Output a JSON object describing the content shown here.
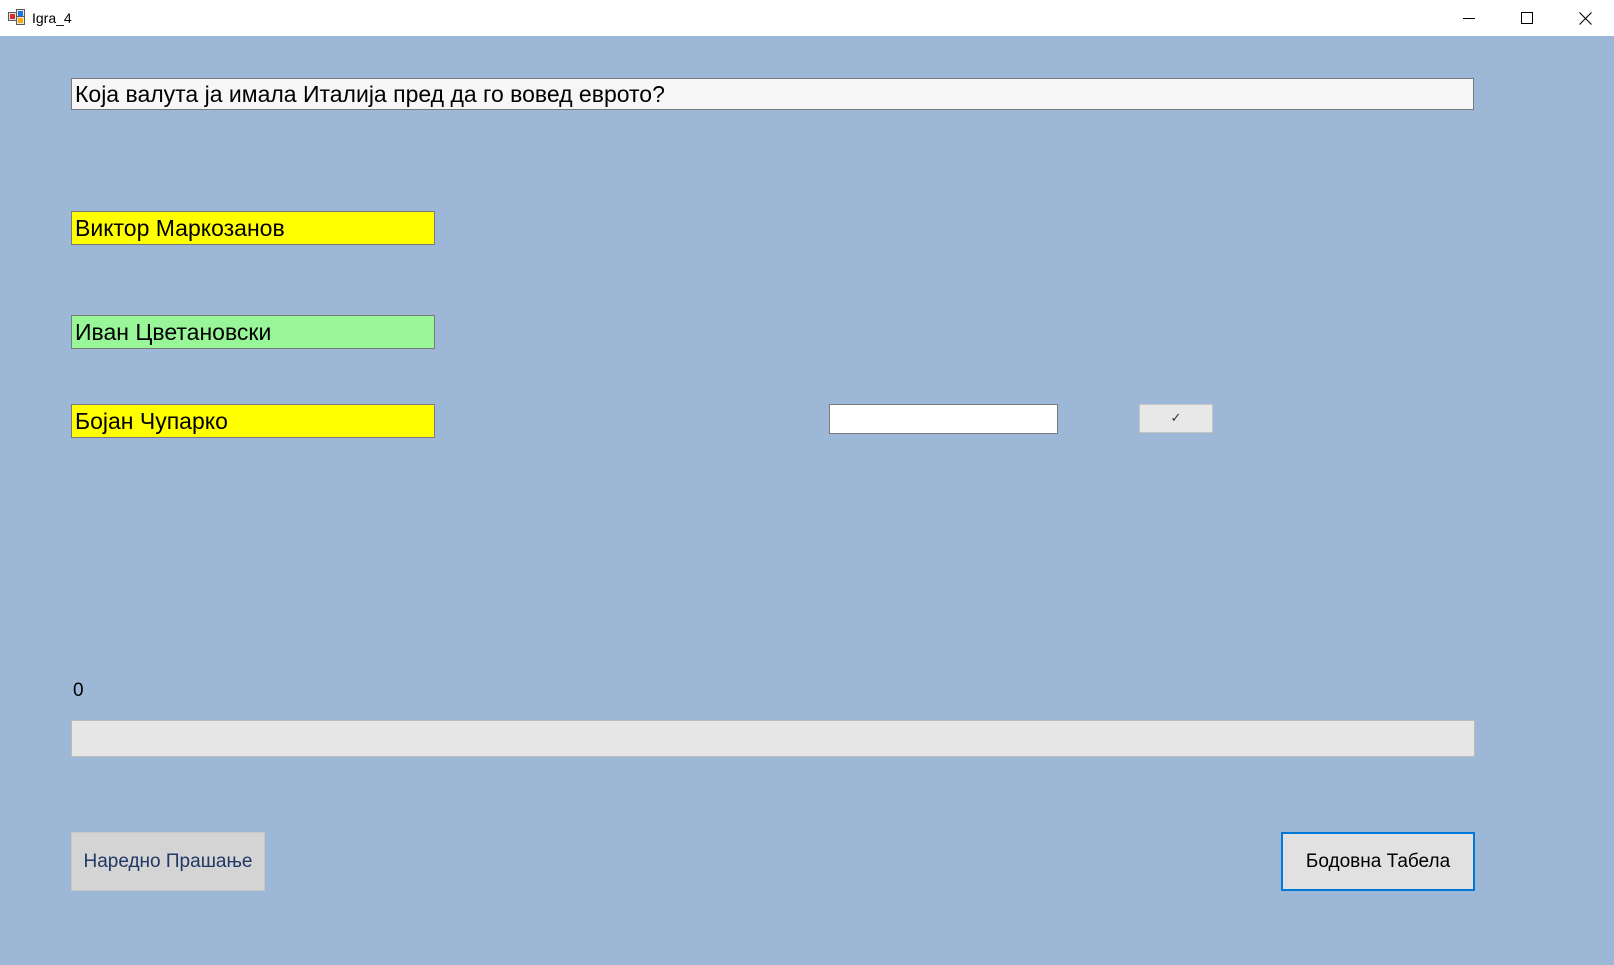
{
  "window": {
    "title": "Igra_4"
  },
  "question": {
    "text": "Која валута ја имала Италија пред да го вовед еврото?"
  },
  "answers": [
    {
      "text": "Виктор Маркозанов",
      "color": "#ffff00"
    },
    {
      "text": "Иван Цветановски",
      "color": "#98f598"
    },
    {
      "text": "Бојан Чупарко",
      "color": "#ffff00"
    }
  ],
  "answer_input": {
    "value": ""
  },
  "check_button": {
    "label": "✓"
  },
  "timer": {
    "value": "0",
    "progress_percent": 0
  },
  "buttons": {
    "next_question": "Наредно Прашање",
    "score_table": "Бодовна Табела"
  },
  "colors": {
    "background": "#9db8d7",
    "focus_border": "#0078d7"
  }
}
